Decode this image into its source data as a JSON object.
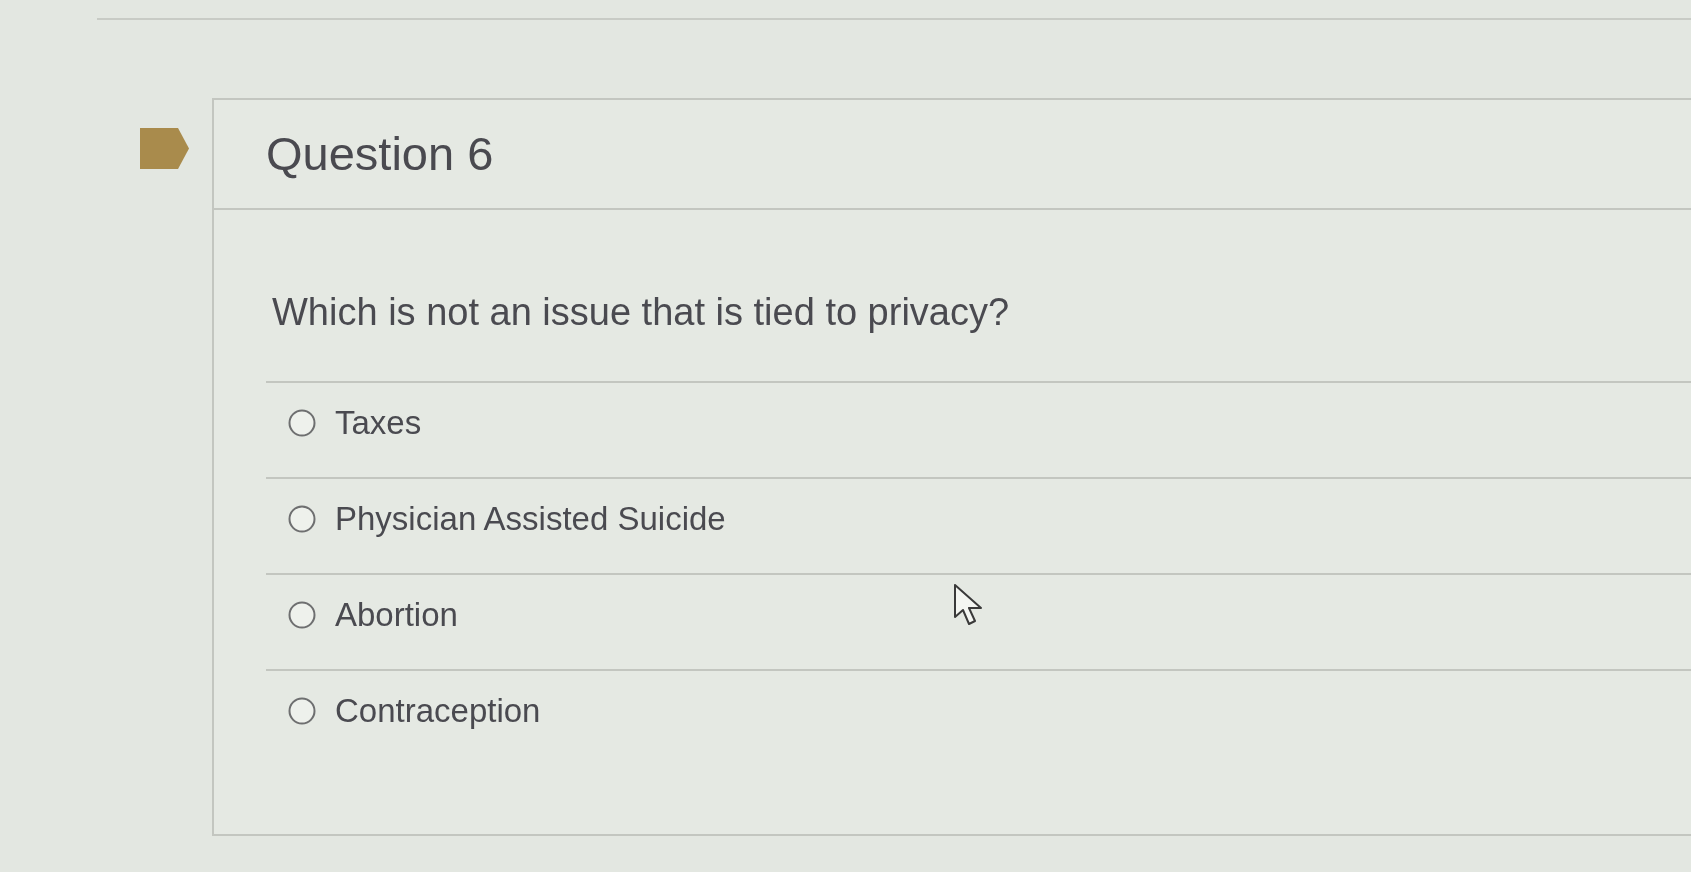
{
  "question": {
    "title": "Question 6",
    "prompt": "Which is not an issue that is tied to privacy?",
    "options": [
      {
        "label": "Taxes",
        "selected": false
      },
      {
        "label": "Physician Assisted Suicide",
        "selected": false
      },
      {
        "label": "Abortion",
        "selected": false
      },
      {
        "label": "Contraception",
        "selected": false
      }
    ]
  }
}
